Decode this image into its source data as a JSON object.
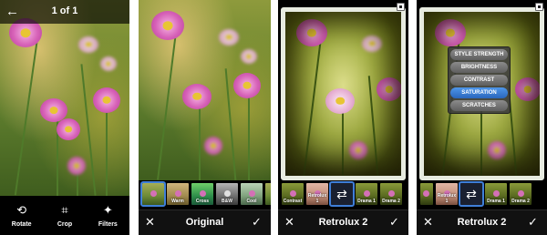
{
  "panel1": {
    "title": "1 of 1",
    "tools": [
      {
        "label": "Rotate",
        "icon": "rotate-icon"
      },
      {
        "label": "Crop",
        "icon": "crop-icon"
      },
      {
        "label": "Filters",
        "icon": "magic-wand-icon"
      }
    ]
  },
  "panel2": {
    "title": "Original",
    "filters": [
      "",
      "Warm",
      "Cross",
      "B&W",
      "Cool",
      ""
    ]
  },
  "panel3": {
    "title": "Retrolux 2",
    "filters": [
      "Contrast",
      "Retrolux 1",
      "",
      "Drama 1",
      "Drama 2"
    ]
  },
  "panel4": {
    "title": "Retrolux 2",
    "filters": [
      "",
      "Retrolux 1",
      "",
      "Drama 1",
      "Drama 2"
    ],
    "menu": [
      "STYLE STRENGTH",
      "BRIGHTNESS",
      "CONTRAST",
      "SATURATION",
      "SCRATCHES"
    ],
    "menu_selected": "SATURATION"
  },
  "colors": {
    "accent": "#3f7fd8",
    "bar": "#111111"
  }
}
